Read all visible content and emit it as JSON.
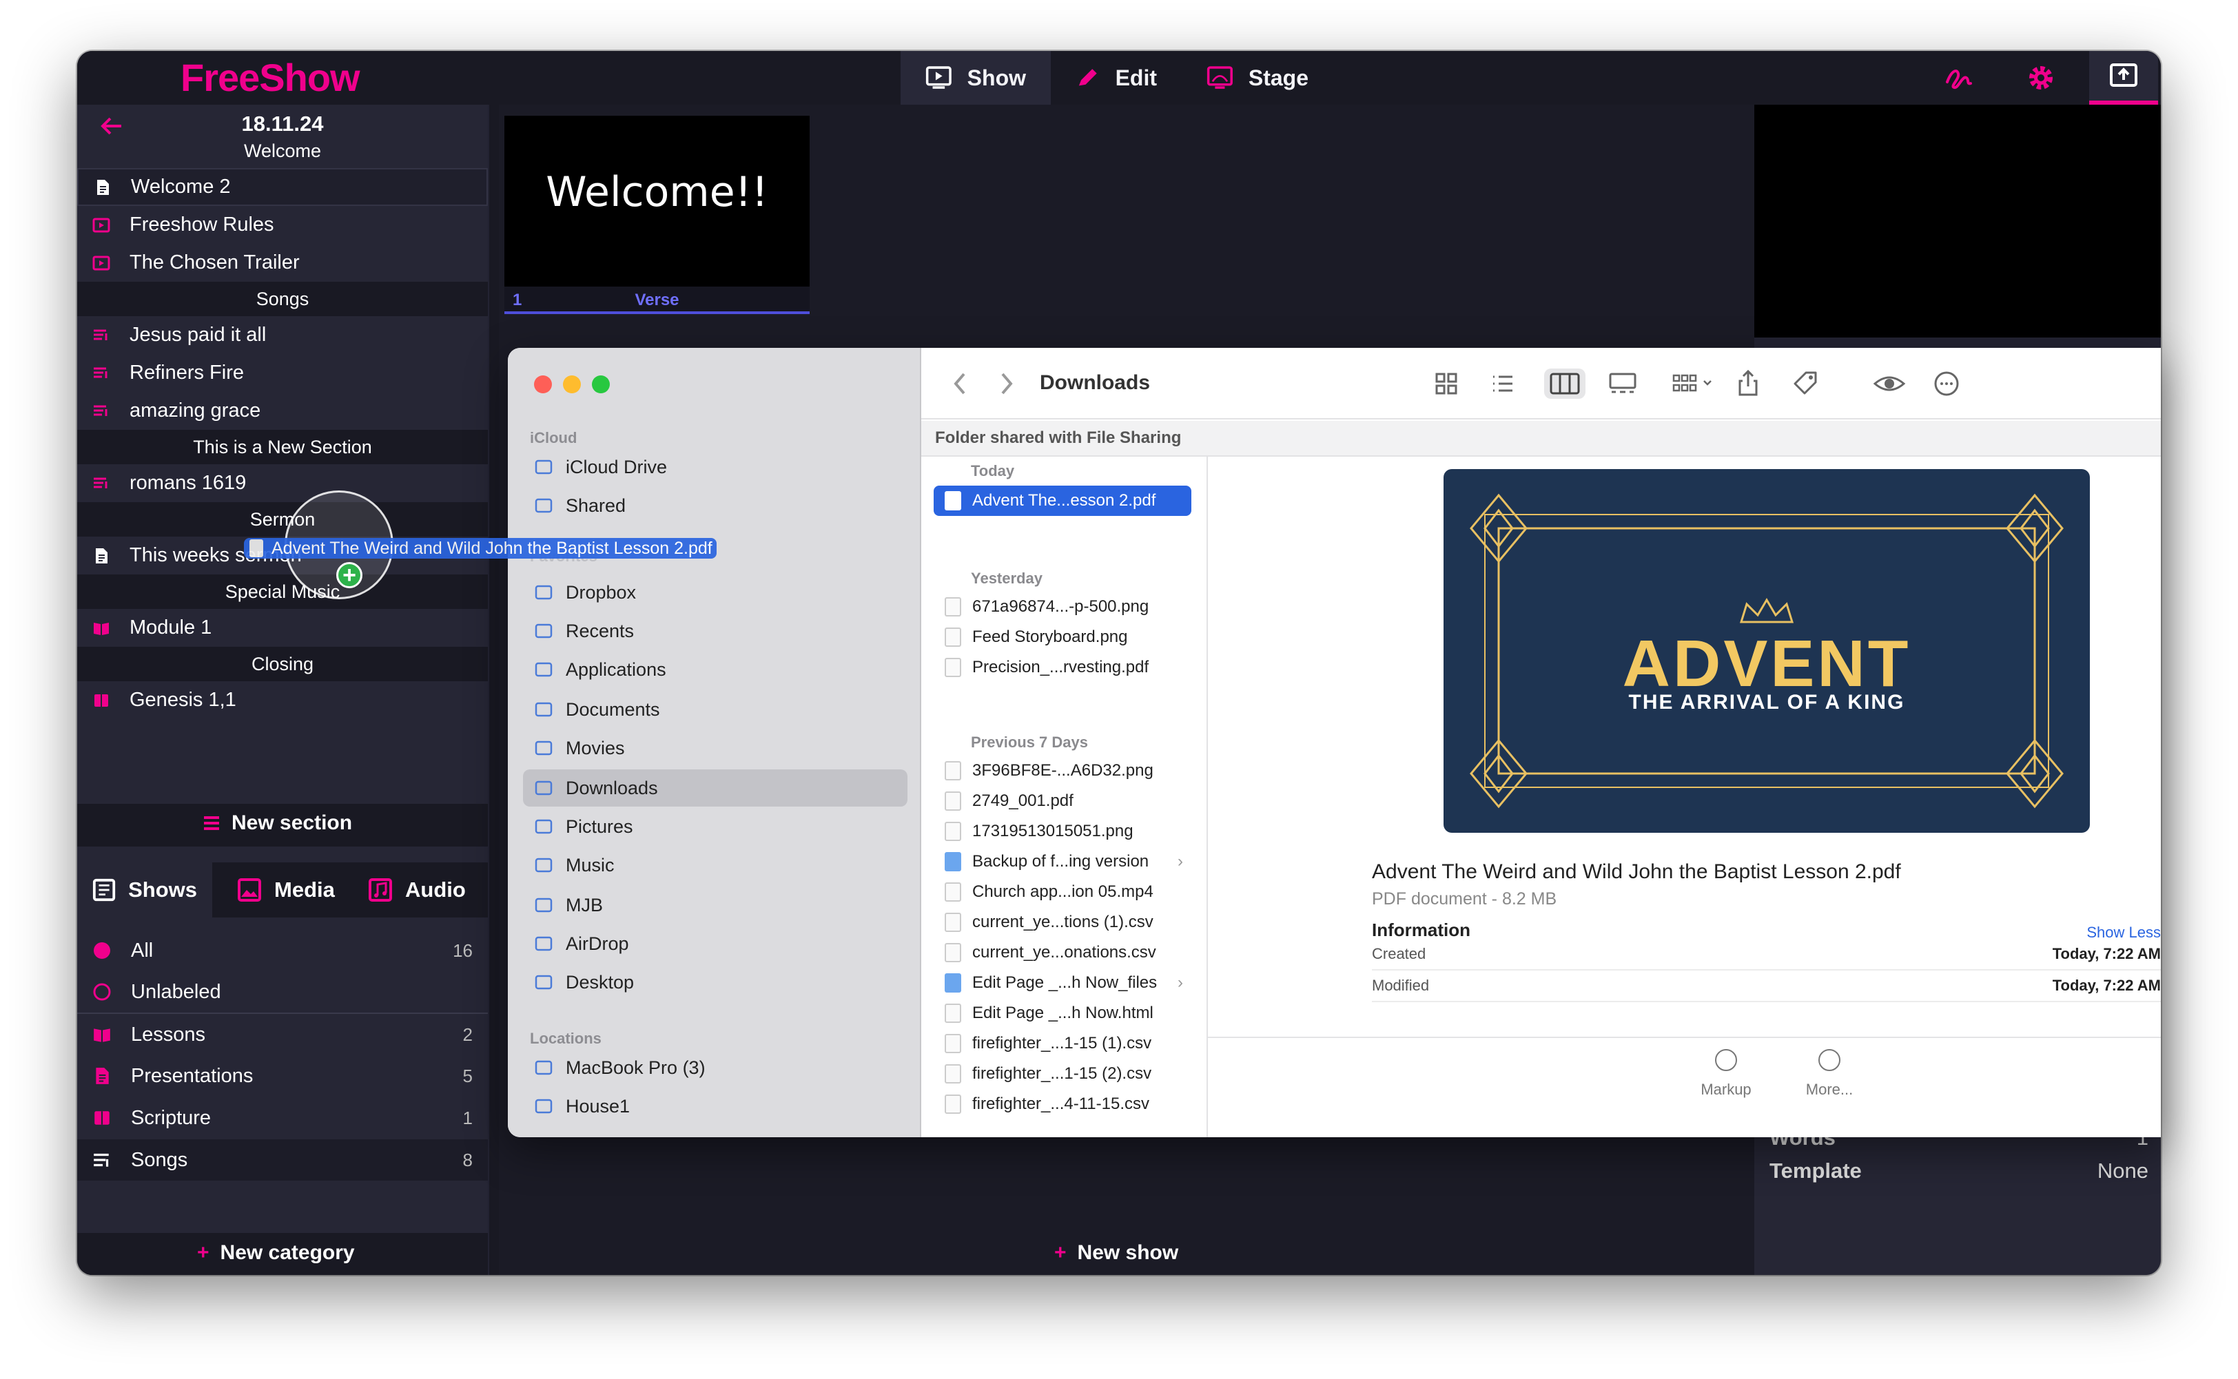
{
  "app": {
    "name": "FreeShow"
  },
  "colors": {
    "accent": "#f0008c",
    "blue": "#6f6fff",
    "background": "#232332",
    "selection": "#2a64e0"
  },
  "main_tabs": [
    {
      "label": "Show",
      "icon": "monitor-play-icon"
    },
    {
      "label": "Edit",
      "icon": "pencil-icon"
    },
    {
      "label": "Stage",
      "icon": "stage-screen-icon"
    }
  ],
  "project": {
    "date": "18.11.24",
    "sections": [
      {
        "name": "Welcome",
        "items": [
          {
            "label": "Welcome 2",
            "type": "presentation"
          },
          {
            "label": "Freeshow Rules",
            "type": "video"
          },
          {
            "label": "The Chosen Trailer",
            "type": "video"
          }
        ]
      },
      {
        "name": "Songs",
        "items": [
          {
            "label": "Jesus paid it all",
            "type": "song"
          },
          {
            "label": "Refiners Fire",
            "type": "song"
          },
          {
            "label": "amazing grace",
            "type": "song"
          }
        ]
      },
      {
        "name": "This is a New Section",
        "items": [
          {
            "label": "romans 1619",
            "type": "song"
          }
        ]
      },
      {
        "name": "Sermon",
        "items": [
          {
            "label": "This weeks sermon",
            "type": "presentation"
          }
        ]
      },
      {
        "name": "Special Music",
        "items": [
          {
            "label": "Module 1",
            "type": "lesson"
          }
        ]
      },
      {
        "name": "Closing",
        "items": [
          {
            "label": "Genesis 1,1",
            "type": "scripture"
          }
        ]
      }
    ],
    "new_section_label": "New section"
  },
  "slide": {
    "text": "Welcome!!",
    "number": "1",
    "group": "Verse"
  },
  "library": {
    "tabs": [
      {
        "label": "Shows",
        "icon": "shows-icon"
      },
      {
        "label": "Media",
        "icon": "image-icon"
      },
      {
        "label": "Audio",
        "icon": "music-icon"
      }
    ],
    "categories": [
      {
        "label": "All",
        "count": "16",
        "icon": "filled-circle-icon"
      },
      {
        "label": "Unlabeled",
        "count": "",
        "icon": "circle-icon"
      },
      {
        "label": "Lessons",
        "count": "2",
        "icon": "book-icon"
      },
      {
        "label": "Presentations",
        "count": "5",
        "icon": "document-icon"
      },
      {
        "label": "Scripture",
        "count": "1",
        "icon": "bible-icon"
      },
      {
        "label": "Songs",
        "count": "8",
        "icon": "lines-icon"
      }
    ],
    "new_category_label": "New category",
    "new_show_label": "New show"
  },
  "properties": [
    {
      "label": "Words",
      "value": "1"
    },
    {
      "label": "Template",
      "value": "None"
    }
  ],
  "drag": {
    "filename": "Advent The Weird and Wild John the Baptist Lesson 2.pdf"
  },
  "finder": {
    "title": "Downloads",
    "banner": "Folder shared with File Sharing",
    "sidebar": [
      {
        "section": "iCloud",
        "items": [
          {
            "label": "iCloud Drive",
            "icon": "cloud-icon"
          },
          {
            "label": "Shared",
            "icon": "shared-folder-icon"
          }
        ]
      },
      {
        "section": "Favorites",
        "items": [
          {
            "label": "Dropbox",
            "icon": "dropbox-icon"
          },
          {
            "label": "Recents",
            "icon": "clock-icon"
          },
          {
            "label": "Applications",
            "icon": "applications-icon"
          },
          {
            "label": "Documents",
            "icon": "document-icon"
          },
          {
            "label": "Movies",
            "icon": "film-icon"
          },
          {
            "label": "Downloads",
            "icon": "download-icon",
            "selected": true
          },
          {
            "label": "Pictures",
            "icon": "photo-icon"
          },
          {
            "label": "Music",
            "icon": "music-note-icon"
          },
          {
            "label": "MJB",
            "icon": "home-icon"
          },
          {
            "label": "AirDrop",
            "icon": "airdrop-icon"
          },
          {
            "label": "Desktop",
            "icon": "desktop-icon"
          }
        ]
      },
      {
        "section": "Locations",
        "items": [
          {
            "label": "MacBook Pro (3)",
            "icon": "laptop-icon"
          },
          {
            "label": "House1",
            "icon": "external-drive-icon"
          }
        ]
      }
    ],
    "groups": [
      {
        "name": "Today",
        "files": [
          {
            "name": "Advent The...esson 2.pdf",
            "selected": true
          }
        ]
      },
      {
        "name": "Yesterday",
        "files": [
          {
            "name": "671a96874...-p-500.png"
          },
          {
            "name": "Feed Storyboard.png"
          },
          {
            "name": "Precision_...rvesting.pdf"
          }
        ]
      },
      {
        "name": "Previous 7 Days",
        "files": [
          {
            "name": "3F96BF8E-...A6D32.png"
          },
          {
            "name": "2749_001.pdf"
          },
          {
            "name": "17319513015051.png"
          },
          {
            "name": "Backup of f...ing version",
            "folder": true
          },
          {
            "name": "Church app...ion 05.mp4"
          },
          {
            "name": "current_ye...tions (1).csv"
          },
          {
            "name": "current_ye...onations.csv"
          },
          {
            "name": "Edit Page _...h Now_files",
            "folder": true
          },
          {
            "name": "Edit Page _...h Now.html"
          },
          {
            "name": "firefighter_...1-15 (1).csv"
          },
          {
            "name": "firefighter_...1-15 (2).csv"
          },
          {
            "name": "firefighter_...4-11-15.csv"
          }
        ]
      }
    ],
    "preview": {
      "poster_title": "ADVENT",
      "poster_subtitle": "THE ARRIVAL OF A KING",
      "filename": "Advent The Weird and Wild John the Baptist Lesson 2.pdf",
      "kind": "PDF document - 8.2 MB",
      "info_label": "Information",
      "show_less": "Show Less",
      "info": [
        {
          "label": "Created",
          "value": "Today, 7:22 AM"
        },
        {
          "label": "Modified",
          "value": "Today, 7:22 AM"
        }
      ],
      "actions": [
        {
          "label": "Markup",
          "icon": "markup-icon"
        },
        {
          "label": "More...",
          "icon": "more-icon"
        }
      ]
    }
  }
}
